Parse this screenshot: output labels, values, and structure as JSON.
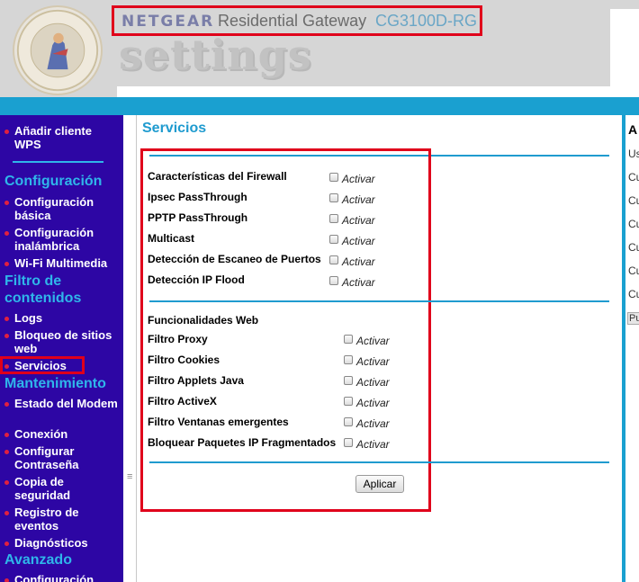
{
  "header": {
    "brand": "NETGEAR",
    "product": "Residential Gateway",
    "model": "CG3100D-RG",
    "settings_word": "settings",
    "seal_text": "SWITCHES | WIRELESS | ROUTERS | ADAPTERS | HUBS"
  },
  "nav": {
    "items": [
      {
        "label": "Añadir cliente WPS"
      },
      {
        "heading": "Configuración"
      },
      {
        "label": "Configuración básica"
      },
      {
        "label": "Configuración inalámbrica"
      },
      {
        "label": "Wi-Fi Multimedia"
      },
      {
        "heading": "Filtro de contenidos"
      },
      {
        "label": "Logs"
      },
      {
        "label": "Bloqueo de sitios web"
      },
      {
        "label": "Servicios",
        "selected": true
      },
      {
        "heading": "Mantenimiento"
      },
      {
        "label": "Estado del Modem"
      },
      {
        "label": "Conexión"
      },
      {
        "label": "Configurar Contraseña"
      },
      {
        "label": "Copia de seguridad"
      },
      {
        "label": "Registro de eventos"
      },
      {
        "label": "Diagnósticos"
      },
      {
        "heading": "Avanzado"
      },
      {
        "label": "Configuración"
      }
    ]
  },
  "main": {
    "title": "Servicios",
    "activate_label": "Activar",
    "firewall_rows": [
      {
        "label": "Características del Firewall",
        "checked": false
      },
      {
        "label": "Ipsec PassThrough",
        "checked": false
      },
      {
        "label": "PPTP PassThrough",
        "checked": false
      },
      {
        "label": "Multicast",
        "checked": false
      },
      {
        "label": "Detección de Escaneo de Puertos",
        "checked": false
      },
      {
        "label": "Detección IP Flood",
        "checked": false
      }
    ],
    "web_section_title": "Funcionalidades Web",
    "web_rows": [
      {
        "label": "Filtro Proxy",
        "checked": false
      },
      {
        "label": "Filtro Cookies",
        "checked": false
      },
      {
        "label": "Filtro Applets Java",
        "checked": false
      },
      {
        "label": "Filtro ActiveX",
        "checked": false
      },
      {
        "label": "Filtro Ventanas emergentes",
        "checked": false
      },
      {
        "label": "Bloquear Paquetes IP Fragmentados",
        "checked": false
      }
    ],
    "apply_label": "Aplicar"
  },
  "right_panel": {
    "heading": "A",
    "items": [
      "Us",
      "Cu",
      "Cu",
      "Cu",
      "Cu",
      "Cu",
      "Cu"
    ],
    "button": "Pu"
  },
  "colors": {
    "nav_bg": "#2d06a4",
    "nav_heading": "#2fb6ea",
    "accent_blue": "#1f9bcf",
    "highlight_red": "#e0001b",
    "cyan_bar": "#1aa0d0"
  }
}
